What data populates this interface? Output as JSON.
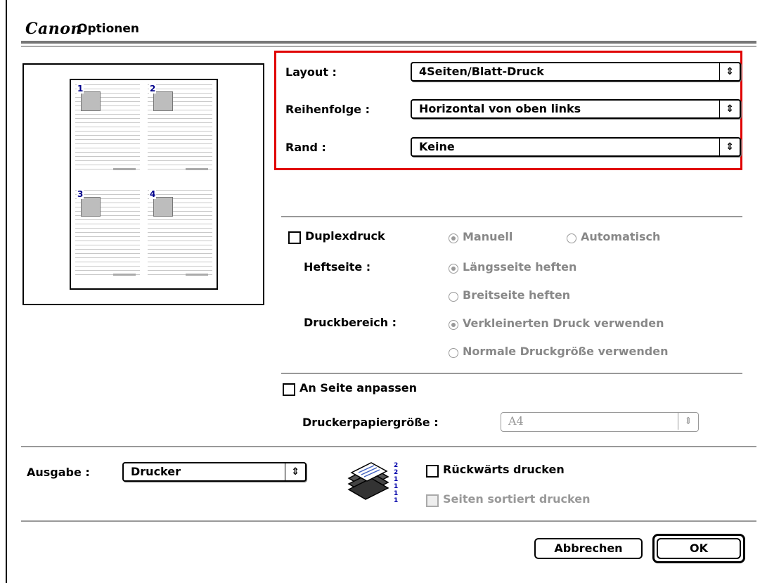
{
  "title": {
    "brand": "Canon",
    "text": "Optionen"
  },
  "preview": {
    "pages": [
      "1",
      "2",
      "3",
      "4"
    ]
  },
  "layout_group": {
    "layout": {
      "label": "Layout :",
      "value": "4Seiten/Blatt-Druck"
    },
    "order": {
      "label": "Reihenfolge :",
      "value": "Horizontal von oben links"
    },
    "border": {
      "label": "Rand :",
      "value": "Keine"
    }
  },
  "duplex": {
    "checkbox_label": "Duplexdruck",
    "mode_manual": "Manuell",
    "mode_auto": "Automatisch",
    "binding_label": "Heftseite :",
    "binding_long": "Längsseite heften",
    "binding_short": "Breitseite heften",
    "area_label": "Druckbereich :",
    "area_reduced": "Verkleinerten Druck verwenden",
    "area_normal": "Normale Druckgröße verwenden"
  },
  "fit": {
    "checkbox_label": "An Seite anpassen",
    "paper_label": "Druckerpapiergröße :",
    "paper_value": "A4"
  },
  "output": {
    "label": "Ausgabe :",
    "value": "Drucker",
    "reverse_label": "Rückwärts drucken",
    "collate_label": "Seiten sortiert drucken"
  },
  "buttons": {
    "cancel": "Abbrechen",
    "ok": "OK"
  },
  "colors": {
    "highlight_border": "#e00000",
    "page_number": "#00008b"
  },
  "icons": {
    "popup_arrow": "⇕",
    "stack_icon": "paper-stack-icon"
  }
}
